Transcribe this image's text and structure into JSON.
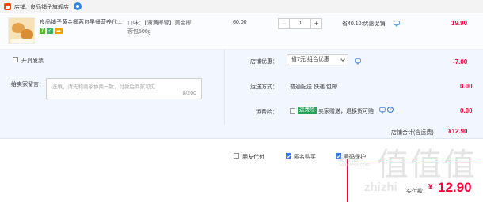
{
  "shop": {
    "label": "店铺:",
    "name": "良品铺子旗舰店"
  },
  "item": {
    "title_line1": "良品铺子黄金椰蓉包早餐营养代...",
    "badges": [
      "7",
      "✓",
      "▬"
    ],
    "sku_text": "口味：【满满椰蓉】黄金椰蓉包500g",
    "price": "60.00",
    "quantity": "1",
    "qty_minus": "−",
    "qty_plus": "+",
    "promo": "省40.10:优惠促销",
    "subtotal": "19.90"
  },
  "invoice": {
    "label": "开具发票"
  },
  "message": {
    "label": "给卖家留言：",
    "placeholder": "选填，请先和商家协商一致，付款后商家可见",
    "counter": "0/200"
  },
  "coupon": {
    "label": "店铺优惠：",
    "selected": "省7元:组合优惠",
    "amount": "-7.00"
  },
  "shipping": {
    "label": "运送方式：",
    "text": "普通配送 快递 包邮",
    "amount": "0.00"
  },
  "insurance": {
    "label": "运费险：",
    "badge": "运费险",
    "text": "卖家赠送，退换货可赔",
    "help": "?",
    "amount": "0.00"
  },
  "shop_total": {
    "label": "店铺合计(含运费)",
    "value": "¥12.90"
  },
  "options": [
    {
      "label": "朋友代付",
      "checked": false
    },
    {
      "label": "匿名购买",
      "checked": true
    },
    {
      "label": "号码保护",
      "checked": true
    }
  ],
  "payment": {
    "label": "实付款：",
    "symbol": "¥",
    "value": "12.90"
  },
  "watermark": {
    "big": "值值值",
    "small": "没得值",
    "site": "Maidebi.com",
    "domain": "zhizhi"
  },
  "colors": {
    "accent": "#ff0036",
    "checkbox_blue": "#3478e5",
    "panel_bg": "#f2f7ff"
  }
}
